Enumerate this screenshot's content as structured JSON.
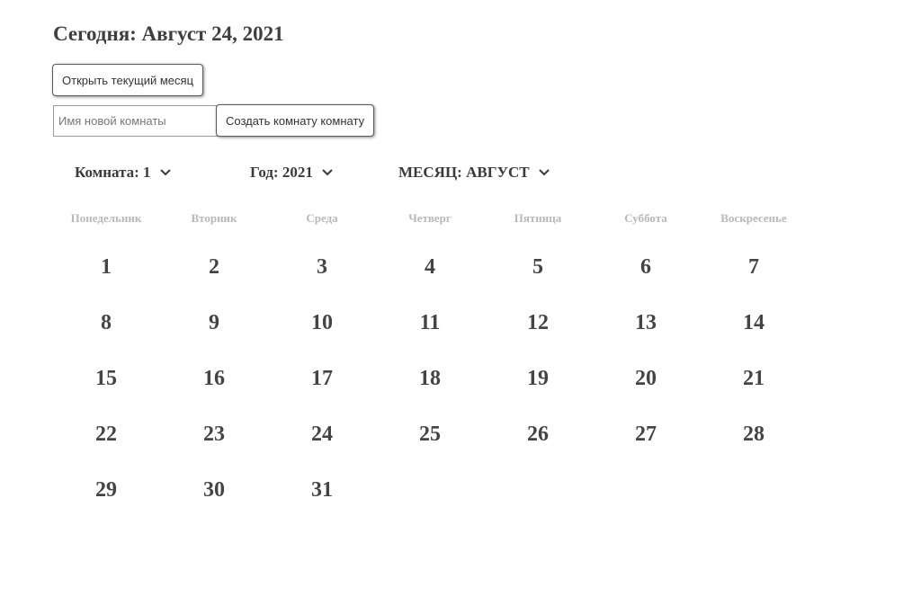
{
  "header": {
    "title": "Сегодня: Август 24, 2021"
  },
  "actions": {
    "open_current_month_label": "Открыть текущий месяц",
    "new_room_placeholder": "Имя новой комнаты",
    "new_room_value": "",
    "create_room_label": "Создать комнату комнату"
  },
  "selectors": {
    "room": "Комната: 1",
    "year": "Год: 2021",
    "month": "МЕСЯЦ: АВГУСТ",
    "icon": "chevron-down-icon"
  },
  "calendar": {
    "weekdays": [
      "Понедельник",
      "Вторник",
      "Среда",
      "Четверг",
      "Пятница",
      "Суббота",
      "Воскресенье"
    ],
    "days": [
      "1",
      "2",
      "3",
      "4",
      "5",
      "6",
      "7",
      "8",
      "9",
      "10",
      "11",
      "12",
      "13",
      "14",
      "15",
      "16",
      "17",
      "18",
      "19",
      "20",
      "21",
      "22",
      "23",
      "24",
      "25",
      "26",
      "27",
      "28",
      "29",
      "30",
      "31"
    ]
  },
  "colors": {
    "text": "#3a3a3a",
    "weekday": "#b8b8b8",
    "border": "#5a5a5a"
  }
}
